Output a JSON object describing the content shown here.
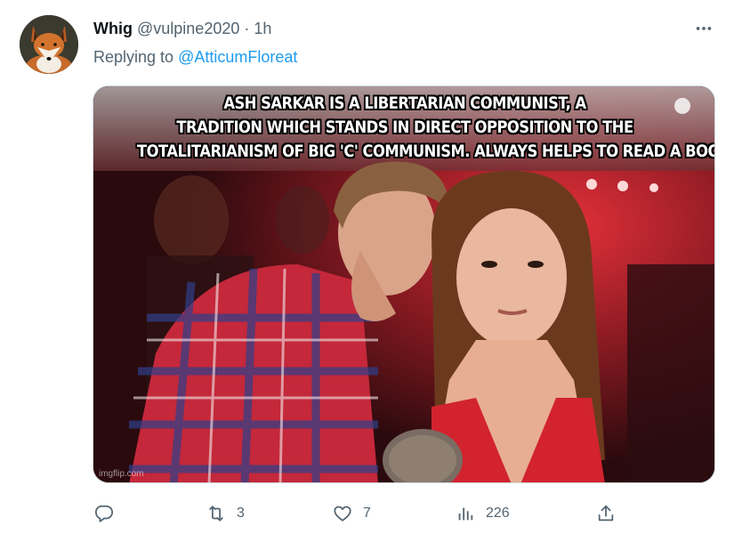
{
  "tweet": {
    "display_name": "Whig",
    "handle": "@vulpine2020",
    "separator": "·",
    "time": "1h",
    "reply_prefix": "Replying to",
    "reply_to": "@AtticumFloreat",
    "avatar_icon": "fox-avatar",
    "more_icon": "more-horizontal-icon"
  },
  "media": {
    "meme_lines": [
      "ASH SARKAR IS A LIBERTARIAN COMMUNIST, A",
      "TRADITION WHICH STANDS IN DIRECT OPPOSITION TO THE",
      "TOTALITARIANISM OF BIG 'C' COMMUNISM. ALWAYS HELPS TO READ A BOOK"
    ],
    "watermark": "imgflip.com"
  },
  "actions": {
    "reply": {
      "icon": "reply-icon",
      "count": ""
    },
    "retweet": {
      "icon": "retweet-icon",
      "count": "3"
    },
    "like": {
      "icon": "heart-icon",
      "count": "7"
    },
    "views": {
      "icon": "analytics-icon",
      "count": "226"
    },
    "share": {
      "icon": "share-icon",
      "count": ""
    }
  },
  "colors": {
    "accent": "#1d9bf0",
    "secondary_text": "#536471",
    "primary_text": "#0f1419"
  }
}
